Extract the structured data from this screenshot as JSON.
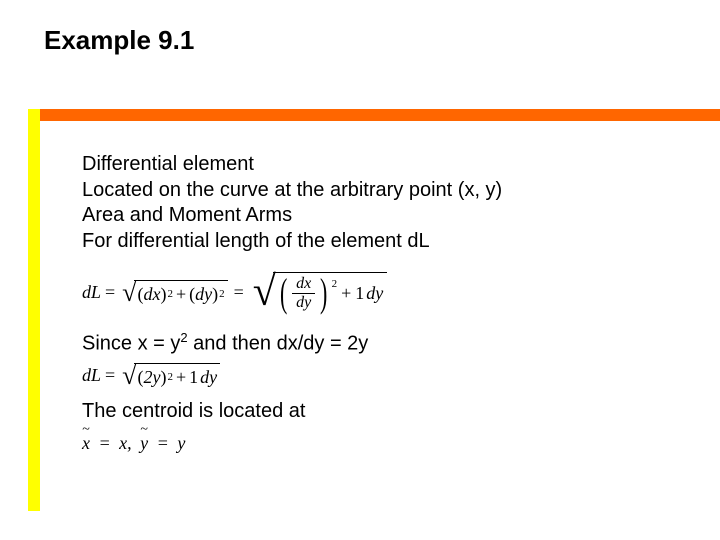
{
  "title": "Example 9.1",
  "lines": {
    "l1": "Differential element",
    "l2": "Located on the curve at the arbitrary point (x, y)",
    "l3": "Area and Moment Arms",
    "l4": "For differential length of the element dL"
  },
  "eq1": {
    "lhs": "dL",
    "eq": "=",
    "r1_dx": "dx",
    "r1_dy": "dy",
    "plus": "+",
    "exp2": "2",
    "one": "1",
    "frac_num": "dx",
    "frac_den": "dy",
    "trail_dy": "dy"
  },
  "line5_a": "Since x = y",
  "line5_sup": "2",
  "line5_b": " and then dx/dy = 2y",
  "eq2": {
    "lhs": "dL",
    "eq": "=",
    "inner": "2y",
    "exp2": "2",
    "plus": "+",
    "one": "1",
    "trail_dy": "dy"
  },
  "line6": "The centroid is located at",
  "eq3": {
    "xt": "x",
    "eq": "=",
    "x": "x",
    "comma": ",",
    "yt": "y",
    "y": "y"
  }
}
